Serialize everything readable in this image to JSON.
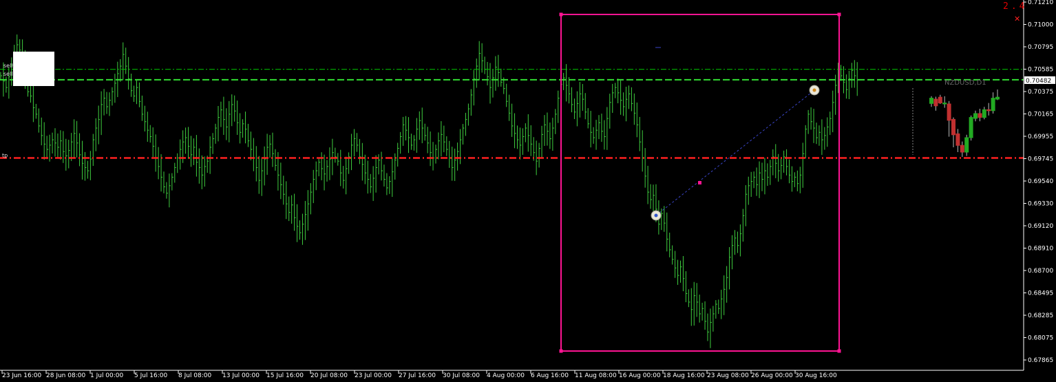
{
  "chart": {
    "symbol_label": "NZDUSD,D1",
    "version_label": "2.4",
    "current_price_label": "0.70482",
    "colors": {
      "background": "#000000",
      "bars": "#3fcf3f",
      "axis_text": "#ffffff",
      "rect": "#ff1493",
      "tp_line": "#00cc00",
      "entry_line": "#33dd33",
      "sl_line": "#ff2020",
      "trend_line": "#3a45c8",
      "bull_candle": "#22aa22",
      "bear_candle": "#c03030"
    },
    "order_tags": [
      "sell",
      "sell"
    ],
    "sl_tag": "tp",
    "y_ticks": [
      "0.71210",
      "0.71000",
      "0.70795",
      "0.70585",
      "0.70375",
      "0.70165",
      "0.69955",
      "0.69745",
      "0.69540",
      "0.69330",
      "0.69120",
      "0.68910",
      "0.68700",
      "0.68495",
      "0.68285",
      "0.68075",
      "0.67865"
    ],
    "x_ticks": [
      "23 Jun 16:00",
      "28 Jun 08:00",
      "1 Jul 00:00",
      "5 Jul 16:00",
      "8 Jul 08:00",
      "13 Jul 00:00",
      "15 Jul 16:00",
      "20 Jul 08:00",
      "23 Jul 00:00",
      "27 Jul 16:00",
      "30 Jul 08:00",
      "4 Aug 00:00",
      "6 Aug 16:00",
      "11 Aug 08:00",
      "16 Aug 00:00",
      "18 Aug 16:00",
      "23 Aug 08:00",
      "26 Aug 00:00",
      "30 Aug 16:00"
    ],
    "levels": {
      "tp_upper": 0.7058,
      "entry": 0.70482,
      "sl": 0.6975
    },
    "closes": [
      0.7052,
      0.7047,
      0.7041,
      0.7051,
      0.7062,
      0.7073,
      0.7081,
      0.7076,
      0.7068,
      0.7049,
      0.7037,
      0.7033,
      0.7022,
      0.7016,
      0.7005,
      0.6996,
      0.6988,
      0.6983,
      0.6987,
      0.6992,
      0.6989,
      0.6985,
      0.6991,
      0.6981,
      0.6977,
      0.6982,
      0.699,
      0.6998,
      0.6989,
      0.6978,
      0.697,
      0.6966,
      0.6963,
      0.6974,
      0.6992,
      0.7003,
      0.7011,
      0.7025,
      0.7031,
      0.7023,
      0.7029,
      0.7037,
      0.7045,
      0.7054,
      0.7061,
      0.7072,
      0.7061,
      0.7049,
      0.7038,
      0.7033,
      0.7041,
      0.7028,
      0.7016,
      0.7009,
      0.7001,
      0.6995,
      0.6986,
      0.6975,
      0.6967,
      0.6957,
      0.6948,
      0.6942,
      0.6949,
      0.6957,
      0.6966,
      0.6975,
      0.6983,
      0.699,
      0.6994,
      0.6986,
      0.6978,
      0.6985,
      0.6971,
      0.6966,
      0.6959,
      0.6967,
      0.6972,
      0.6985,
      0.6993,
      0.7003,
      0.7013,
      0.702,
      0.7011,
      0.7004,
      0.7016,
      0.7025,
      0.7019,
      0.7008,
      0.6999,
      0.7007,
      0.7002,
      0.6991,
      0.6983,
      0.6975,
      0.6966,
      0.6954,
      0.6963,
      0.6974,
      0.6985,
      0.6988,
      0.6979,
      0.6968,
      0.6959,
      0.695,
      0.6941,
      0.6932,
      0.6924,
      0.6931,
      0.6919,
      0.6911,
      0.6905,
      0.6913,
      0.6922,
      0.6932,
      0.6943,
      0.6955,
      0.6963,
      0.6971,
      0.6965,
      0.696,
      0.6967,
      0.6974,
      0.698,
      0.6976,
      0.6972,
      0.6961,
      0.6954,
      0.6965,
      0.6976,
      0.6987,
      0.6993,
      0.6987,
      0.6976,
      0.6969,
      0.6961,
      0.6955,
      0.6948,
      0.6956,
      0.6966,
      0.6973,
      0.6963,
      0.6955,
      0.6947,
      0.6953,
      0.6962,
      0.6973,
      0.6984,
      0.6995,
      0.7006,
      0.7001,
      0.6994,
      0.6987,
      0.6992,
      0.7002,
      0.701,
      0.7003,
      0.6996,
      0.6989,
      0.698,
      0.6975,
      0.6983,
      0.6991,
      0.6997,
      0.699,
      0.6983,
      0.6975,
      0.6966,
      0.6973,
      0.6981,
      0.6992,
      0.7003,
      0.7011,
      0.7021,
      0.7034,
      0.7049,
      0.7061,
      0.7073,
      0.7066,
      0.7058,
      0.7051,
      0.7041,
      0.705,
      0.706,
      0.7055,
      0.7046,
      0.704,
      0.7028,
      0.7017,
      0.7005,
      0.6998,
      0.6992,
      0.6987,
      0.6995,
      0.7003,
      0.6996,
      0.6988,
      0.698,
      0.6972,
      0.6984,
      0.6997,
      0.7006,
      0.7,
      0.6993,
      0.7003,
      0.7016,
      0.7031,
      0.7044,
      0.705,
      0.7043,
      0.7035,
      0.7025,
      0.7018,
      0.7026,
      0.7035,
      0.703,
      0.7018,
      0.7007,
      0.6999,
      0.6994,
      0.7001,
      0.7008,
      0.7,
      0.6995,
      0.7012,
      0.7027,
      0.7036,
      0.7041,
      0.7036,
      0.7029,
      0.7023,
      0.703,
      0.7035,
      0.7026,
      0.7017,
      0.7006,
      0.699,
      0.6975,
      0.6958,
      0.6943,
      0.6936,
      0.694,
      0.6927,
      0.6913,
      0.6923,
      0.6914,
      0.6899,
      0.6889,
      0.688,
      0.6872,
      0.6865,
      0.6873,
      0.6862,
      0.6848,
      0.684,
      0.6833,
      0.6846,
      0.684,
      0.6829,
      0.6834,
      0.6822,
      0.6812,
      0.6821,
      0.6829,
      0.6838,
      0.6834,
      0.6843,
      0.6852,
      0.6863,
      0.6882,
      0.6893,
      0.69,
      0.6893,
      0.6904,
      0.6921,
      0.6941,
      0.6949,
      0.6953,
      0.6957,
      0.695,
      0.6961,
      0.6955,
      0.6963,
      0.6957,
      0.6967,
      0.6976,
      0.697,
      0.6963,
      0.6968,
      0.6976,
      0.6967,
      0.6959,
      0.6953,
      0.6957,
      0.6951,
      0.6959,
      0.6979,
      0.7002,
      0.7016,
      0.7009,
      0.7003,
      0.6994,
      0.6999,
      0.6992,
      0.6996,
      0.7004,
      0.7012,
      0.7027,
      0.7043,
      0.7058,
      0.7052,
      0.7046,
      0.7039,
      0.7049,
      0.7057,
      0.7052,
      0.7048
    ],
    "candles": [
      {
        "o": 0.70305,
        "c": 0.7036,
        "h": 0.7038,
        "l": 0.7027
      },
      {
        "o": 0.7035,
        "c": 0.7028,
        "h": 0.70375,
        "l": 0.7023
      },
      {
        "o": 0.7037,
        "c": 0.7031,
        "h": 0.70395,
        "l": 0.703
      },
      {
        "o": 0.703,
        "c": 0.7031,
        "h": 0.7038,
        "l": 0.7026
      },
      {
        "o": 0.703,
        "c": 0.7013,
        "h": 0.7033,
        "l": 0.6996
      },
      {
        "o": 0.7014,
        "c": 0.6998,
        "h": 0.7016,
        "l": 0.6985
      },
      {
        "o": 0.6999,
        "c": 0.6987,
        "h": 0.7004,
        "l": 0.698
      },
      {
        "o": 0.6987,
        "c": 0.698,
        "h": 0.6991,
        "l": 0.6975
      },
      {
        "o": 0.698,
        "c": 0.6995,
        "h": 0.6998,
        "l": 0.6976
      },
      {
        "o": 0.6995,
        "c": 0.7016,
        "h": 0.7018,
        "l": 0.6992
      },
      {
        "o": 0.7015,
        "c": 0.702,
        "h": 0.7023,
        "l": 0.7012
      },
      {
        "o": 0.702,
        "c": 0.7016,
        "h": 0.7025,
        "l": 0.7012
      },
      {
        "o": 0.7016,
        "c": 0.7024,
        "h": 0.7027,
        "l": 0.7014
      },
      {
        "o": 0.7024,
        "c": 0.7023,
        "h": 0.7031,
        "l": 0.7018
      },
      {
        "o": 0.7023,
        "c": 0.7036,
        "h": 0.7042,
        "l": 0.702
      },
      {
        "o": 0.7035,
        "c": 0.7037,
        "h": 0.7045,
        "l": 0.7034
      }
    ]
  }
}
